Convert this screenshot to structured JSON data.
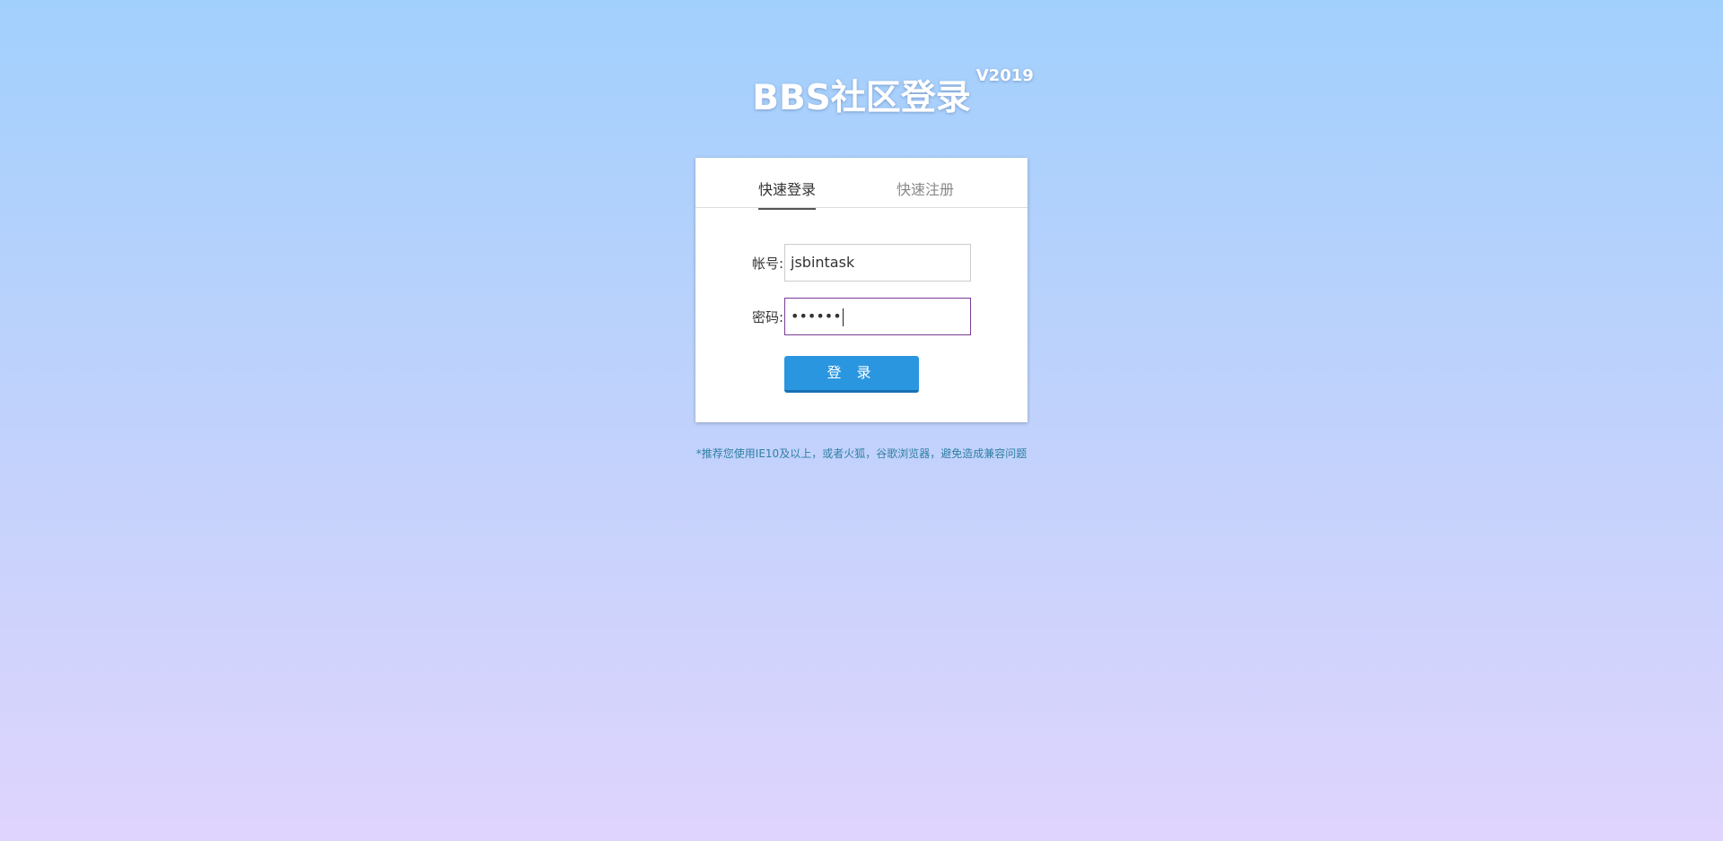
{
  "header": {
    "title": "BBS社区登录",
    "version": "V2019"
  },
  "tabs": [
    {
      "label": "快速登录",
      "active": true
    },
    {
      "label": "快速注册",
      "active": false
    }
  ],
  "form": {
    "account_label": "帐号:",
    "account_value": "jsbintask",
    "password_label": "密码:",
    "password_masked": "••••••",
    "submit_label": "登 录"
  },
  "footer": {
    "note": "*推荐您使用IE10及以上，或者火狐，谷歌浏览器，避免造成兼容问题"
  },
  "colors": {
    "accent": "#2a96e0",
    "focus_border": "#7b3a96",
    "note_text": "#2f7fa3"
  }
}
